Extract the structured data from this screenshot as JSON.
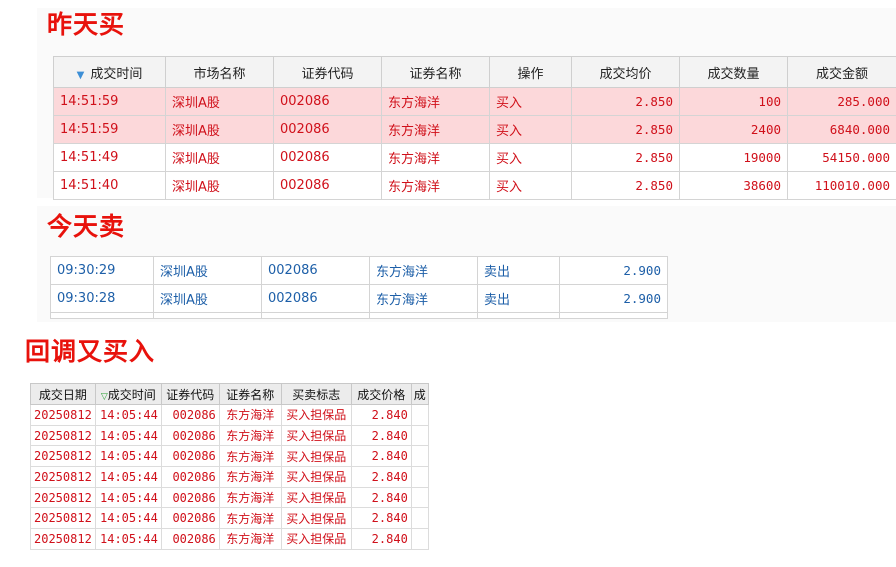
{
  "headings": {
    "yesterday": "昨天买",
    "today": "今天卖",
    "rebuy": "回调又买入"
  },
  "table1": {
    "columns": [
      "成交时间",
      "市场名称",
      "证券代码",
      "证券名称",
      "操作",
      "成交均价",
      "成交数量",
      "成交金额"
    ],
    "rows": [
      [
        "14:51:59",
        "深圳A股",
        "002086",
        "东方海洋",
        "买入",
        "2.850",
        "100",
        "285.000"
      ],
      [
        "14:51:59",
        "深圳A股",
        "002086",
        "东方海洋",
        "买入",
        "2.850",
        "2400",
        "6840.000"
      ],
      [
        "14:51:49",
        "深圳A股",
        "002086",
        "东方海洋",
        "买入",
        "2.850",
        "19000",
        "54150.000"
      ],
      [
        "14:51:40",
        "深圳A股",
        "002086",
        "东方海洋",
        "买入",
        "2.850",
        "38600",
        "110010.000"
      ]
    ]
  },
  "table2": {
    "rows": [
      [
        "09:30:29",
        "深圳A股",
        "002086",
        "东方海洋",
        "卖出",
        "2.900"
      ],
      [
        "09:30:28",
        "深圳A股",
        "002086",
        "东方海洋",
        "卖出",
        "2.900"
      ]
    ]
  },
  "table3": {
    "columns": [
      "成交日期",
      "成交时间",
      "证券代码",
      "证券名称",
      "买卖标志",
      "成交价格",
      "成"
    ],
    "rows": [
      [
        "20250812",
        "14:05:44",
        "002086",
        "东方海洋",
        "买入担保品",
        "2.840"
      ],
      [
        "20250812",
        "14:05:44",
        "002086",
        "东方海洋",
        "买入担保品",
        "2.840"
      ],
      [
        "20250812",
        "14:05:44",
        "002086",
        "东方海洋",
        "买入担保品",
        "2.840"
      ],
      [
        "20250812",
        "14:05:44",
        "002086",
        "东方海洋",
        "买入担保品",
        "2.840"
      ],
      [
        "20250812",
        "14:05:44",
        "002086",
        "东方海洋",
        "买入担保品",
        "2.840"
      ],
      [
        "20250812",
        "14:05:44",
        "002086",
        "东方海洋",
        "买入担保品",
        "2.840"
      ],
      [
        "20250812",
        "14:05:44",
        "002086",
        "东方海洋",
        "买入担保品",
        "2.840"
      ]
    ]
  },
  "colors": {
    "heading": "#e8120c",
    "buy_text": "#d0101a",
    "sell_text": "#1d5fa8",
    "highlight_row": "#fcd8da"
  },
  "icons": {
    "table1_sort": "sort-down-triangle-icon",
    "table3_sort": "sort-down-triangle-icon"
  }
}
